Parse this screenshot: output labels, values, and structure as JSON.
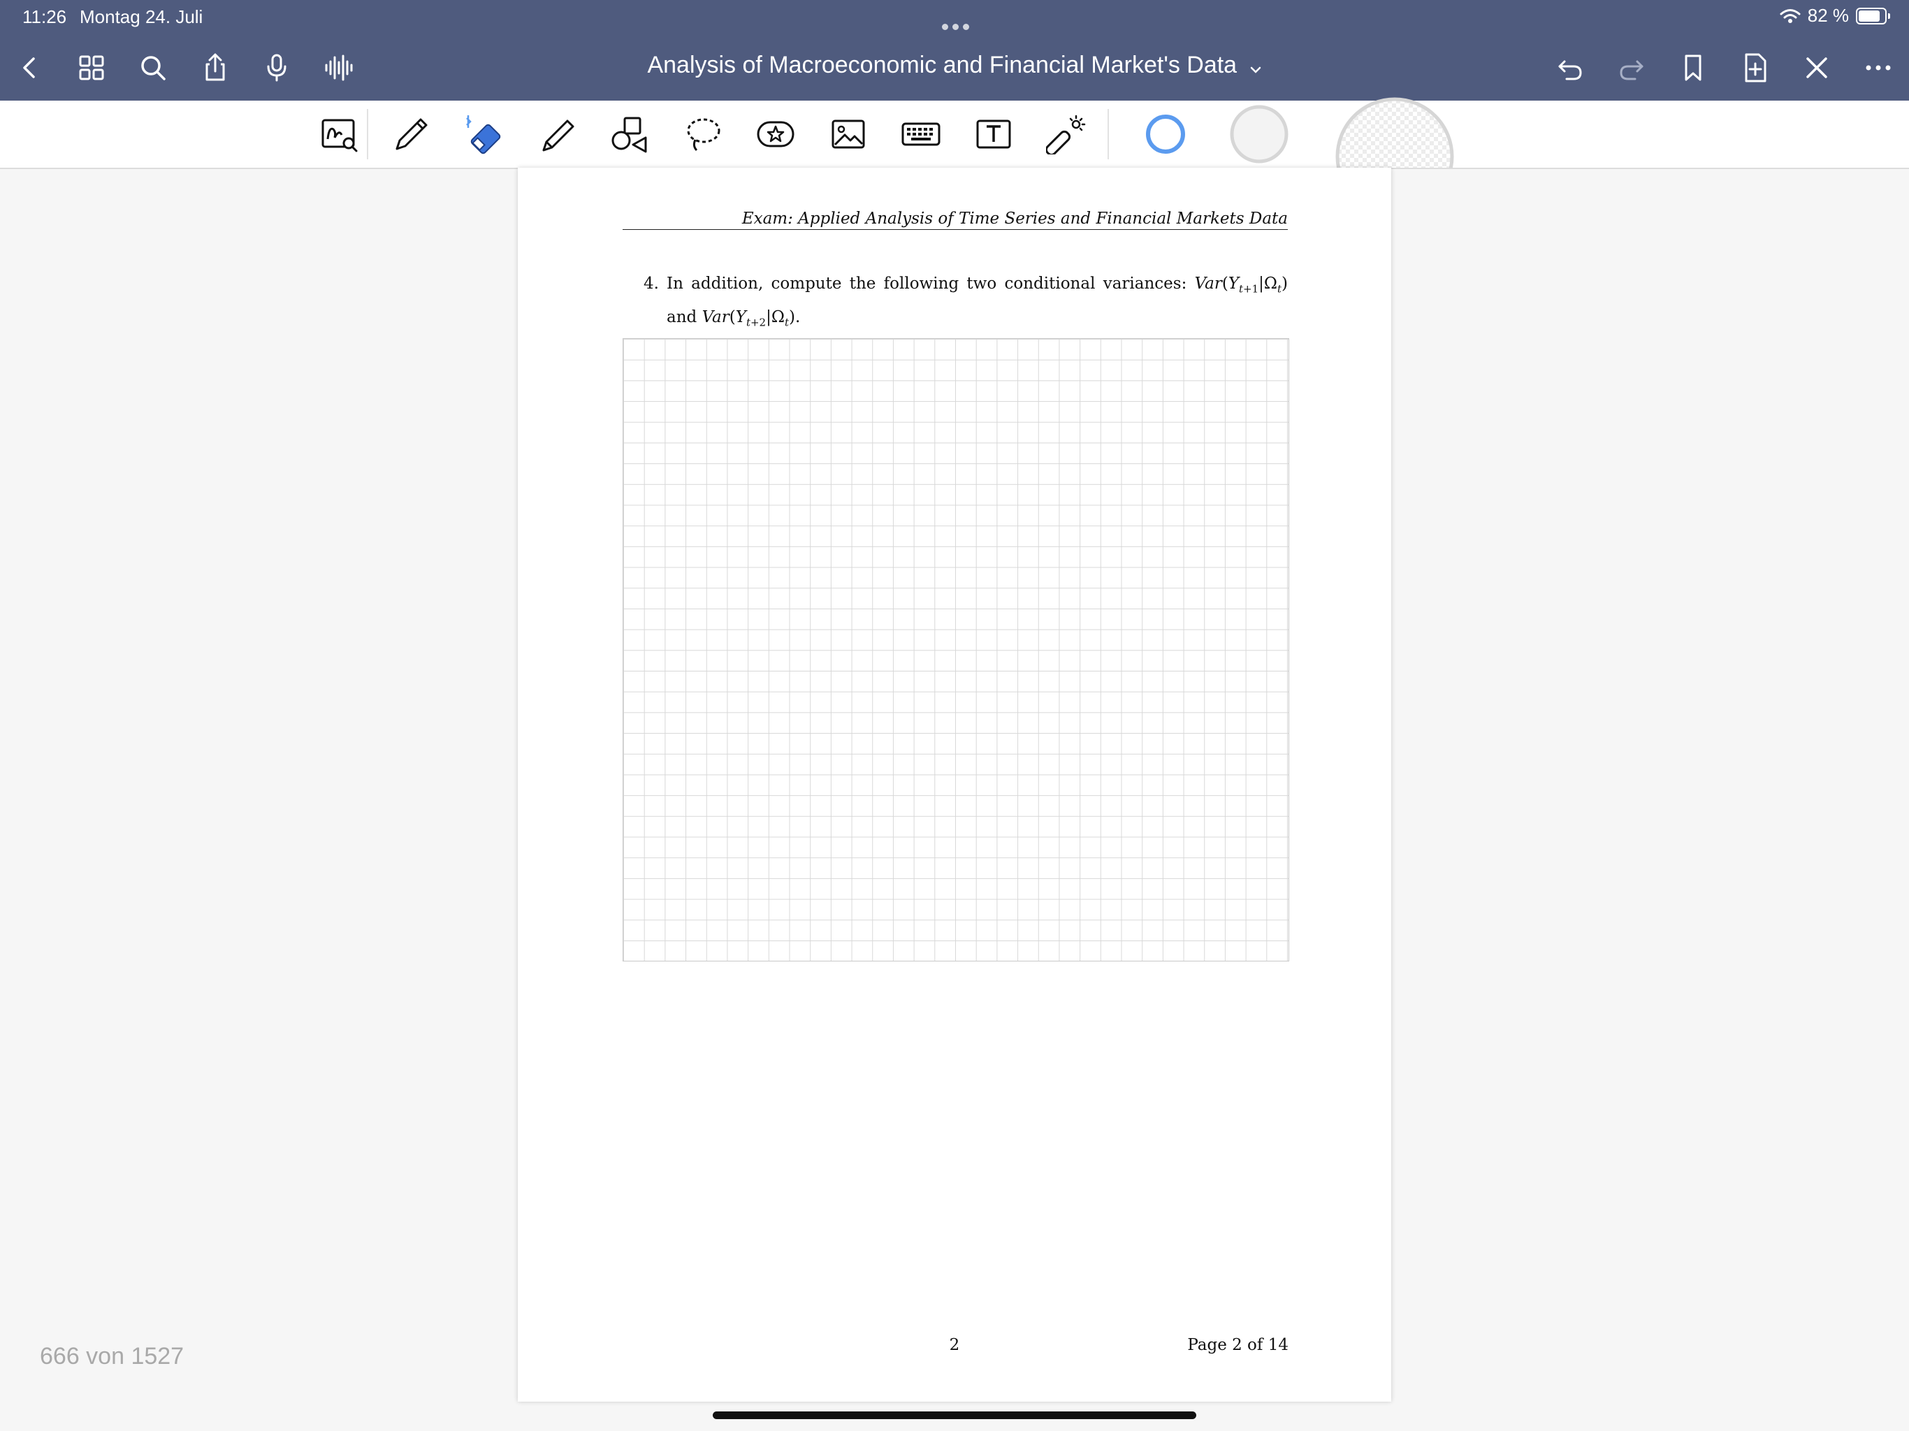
{
  "status_bar": {
    "time": "11:26",
    "date": "Montag 24. Juli",
    "battery_percent": "82 %",
    "battery_level": 0.82
  },
  "navbar": {
    "title": "Analysis of Macroeconomic and Financial Market's Data",
    "left_icons": [
      "back-icon",
      "thumbnails-grid-icon",
      "search-icon",
      "share-icon",
      "microphone-icon",
      "audio-wave-icon"
    ],
    "right_icons": [
      "undo-icon",
      "redo-icon",
      "bookmark-icon",
      "add-page-icon",
      "close-icon",
      "more-icon"
    ]
  },
  "toolbar": {
    "tools": [
      "zoom-window-icon",
      "pen-icon",
      "eraser-icon",
      "highlighter-icon",
      "shapes-icon",
      "lasso-icon",
      "sticker-icon",
      "image-icon",
      "keyboard-icon",
      "text-box-icon",
      "laser-pointer-icon"
    ],
    "active_tool": "eraser-icon",
    "colors": {
      "accent": "#5b9bef",
      "topbar": "#4f5b7e"
    }
  },
  "document": {
    "running_header": "Exam: Applied Analysis of Time Series and Financial Markets Data",
    "question_number": "4.",
    "question_text_before": "In addition, compute the following two conditional variances: ",
    "question_and": "and",
    "page_number": "2",
    "page_of": "Page 2 of 14"
  },
  "page_counter": "666 von 1527"
}
